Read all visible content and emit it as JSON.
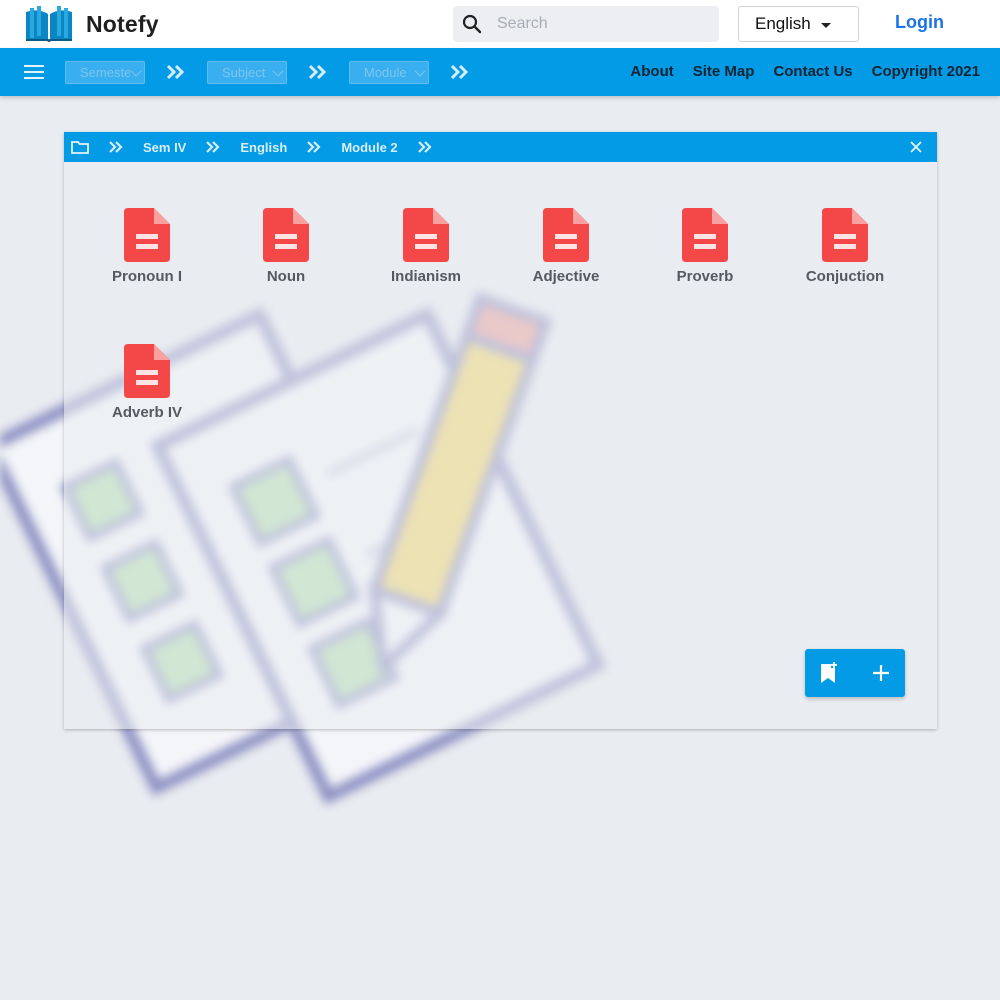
{
  "header": {
    "app_name": "Notefy",
    "search_placeholder": "Search",
    "language": "English",
    "login_label": "Login"
  },
  "navbar": {
    "selects": [
      "Semester",
      "Subject",
      "Module"
    ],
    "links": [
      "About",
      "Site Map",
      "Contact Us",
      "Copyright 2021"
    ]
  },
  "panel": {
    "breadcrumb": [
      "Sem IV",
      "English",
      "Module 2"
    ],
    "files": [
      "Pronoun I",
      "Noun",
      "Indianism",
      "Adjective",
      "Proverb",
      "Conjuction",
      "Adverb IV"
    ]
  },
  "colors": {
    "primary": "#039be5",
    "file_icon": "#f44848",
    "link": "#1a73e8"
  },
  "icons": [
    "book-logo-icon",
    "search-icon",
    "caret-down-icon",
    "menu-icon",
    "double-chevron-right-icon",
    "folder-icon",
    "close-icon",
    "document-icon",
    "bookmark-add-icon",
    "plus-icon"
  ]
}
